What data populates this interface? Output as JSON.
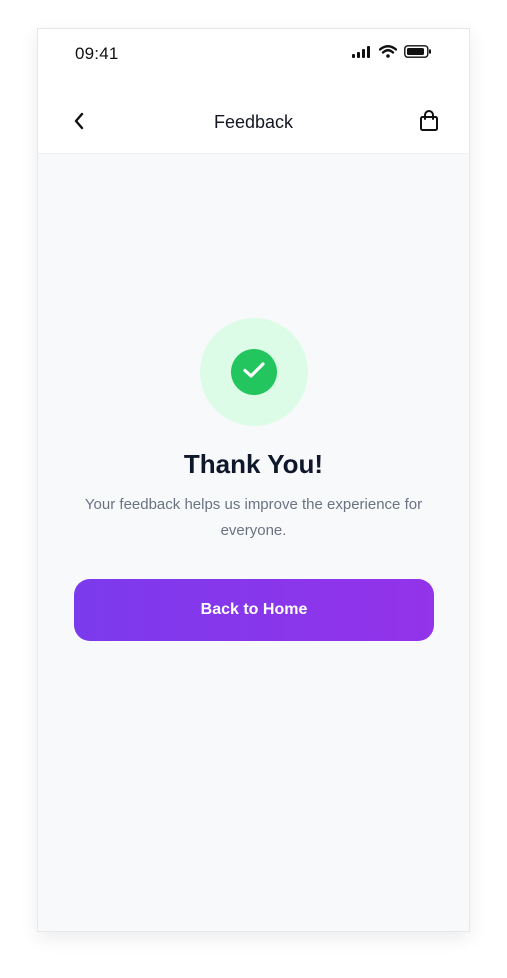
{
  "status_bar": {
    "time": "09:41",
    "icons": [
      "signal-icon",
      "wifi-icon",
      "battery-icon"
    ]
  },
  "nav": {
    "title": "Feedback",
    "back_icon": "chevron-left-icon",
    "bag_icon": "shopping-bag-icon"
  },
  "success": {
    "icon": "check-icon",
    "title": "Thank You!",
    "message": "Your feedback helps us improve the experience for everyone."
  },
  "actions": {
    "home_label": "Back to Home"
  },
  "colors": {
    "accent_start": "#7c3aed",
    "accent_end": "#9333ea",
    "success": "#22c55e",
    "success_bg": "#dcfce7"
  }
}
